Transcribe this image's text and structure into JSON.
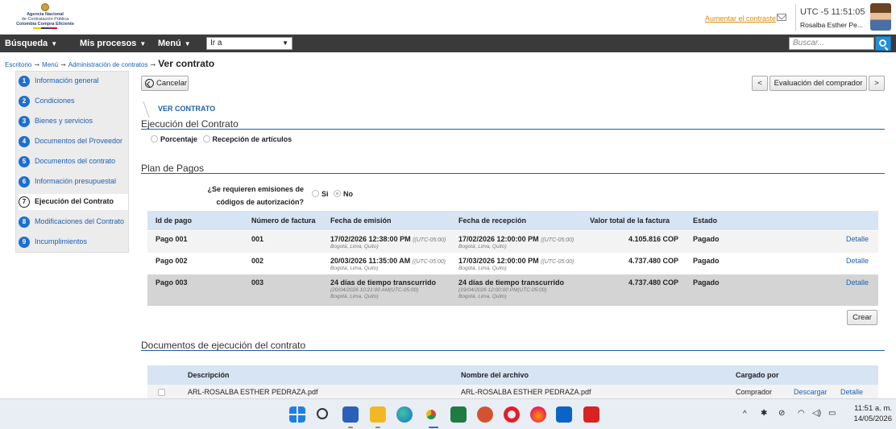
{
  "header": {
    "logo": {
      "line1": "Agencia Nacional",
      "line2": "de Contratación Pública",
      "line3": "Colombia Compra Eficiente"
    },
    "contrast_link": "Aumentar el contraste",
    "time": "UTC -5 11:51:05",
    "user_name": "Rosalba Esther Pe..."
  },
  "nav": {
    "busqueda": "Búsqueda",
    "mis_procesos": "Mis procesos",
    "menu": "Menú",
    "ira": "Ir a",
    "search_placeholder": "Buscar..."
  },
  "breadcrumb": {
    "items": [
      "Escritorio",
      "Menú",
      "Administración de contratos"
    ],
    "current": "Ver contrato"
  },
  "steps": [
    {
      "num": "1",
      "label": "Información general"
    },
    {
      "num": "2",
      "label": "Condiciones"
    },
    {
      "num": "3",
      "label": "Bienes y servicios"
    },
    {
      "num": "4",
      "label": "Documentos del Proveedor"
    },
    {
      "num": "5",
      "label": "Documentos del contrato"
    },
    {
      "num": "6",
      "label": "Información presupuestal"
    },
    {
      "num": "7",
      "label": "Ejecución del Contrato"
    },
    {
      "num": "8",
      "label": "Modificaciones del Contrato"
    },
    {
      "num": "9",
      "label": "Incumplimientos"
    }
  ],
  "toolbar": {
    "cancel": "Cancelar",
    "prev": "<",
    "eval": "Evaluación del comprador",
    "next": ">"
  },
  "tab_label": "VER CONTRATO",
  "ejecucion": {
    "title": "Ejecución del Contrato",
    "opt1": "Porcentaje",
    "opt2": "Recepción de artículos"
  },
  "plan": {
    "title": "Plan de Pagos",
    "question": "¿Se requieren emisiones de códigos de autorización?",
    "si": "Si",
    "no": "No",
    "columns": [
      "Id de pago",
      "Número de factura",
      "Fecha de emisión",
      "Fecha de recepción",
      "Valor total de la factura",
      "Estado"
    ],
    "rows": [
      {
        "id": "Pago 001",
        "factura": "001",
        "emision": "17/02/2026 12:38:00 PM",
        "emision_tz": "((UTC-05:00)",
        "emision_sub": "Bogotá, Lima, Quito)",
        "recepcion": "17/02/2026 12:00:00 PM",
        "recepcion_tz": "((UTC-05:00)",
        "recepcion_sub": "Bogotá, Lima, Quito)",
        "valor": "4.105.816 COP",
        "estado": "Pagado",
        "detalle": "Detalle"
      },
      {
        "id": "Pago 002",
        "factura": "002",
        "emision": "20/03/2026 11:35:00 AM",
        "emision_tz": "((UTC-05:00)",
        "emision_sub": "Bogotá, Lima, Quito)",
        "recepcion": "17/03/2026 12:00:00 PM",
        "recepcion_tz": "((UTC-05:00)",
        "recepcion_sub": "Bogotá, Lima, Quito)",
        "valor": "4.737.480 COP",
        "estado": "Pagado",
        "detalle": "Detalle"
      },
      {
        "id": "Pago 003",
        "factura": "003",
        "emision": "24 días de tiempo transcurrido",
        "emision_tz": "",
        "emision_sub": "(20/04/2026 10:21:00 AM(UTC-05:00)",
        "emision_sub2": "Bogotá, Lima, Quito)",
        "recepcion": "24 días de tiempo transcurrido",
        "recepcion_tz": "",
        "recepcion_sub": "(19/04/2026 12:00:00 PM(UTC-05:00)",
        "recepcion_sub2": "Bogotá, Lima, Quito)",
        "valor": "4.737.480 COP",
        "estado": "Pagado",
        "detalle": "Detalle"
      }
    ],
    "crear": "Crear"
  },
  "documentos": {
    "title": "Documentos de ejecución del contrato",
    "columns": [
      "Descripción",
      "Nombre del archivo",
      "Cargado por"
    ],
    "rows": [
      {
        "descripcion": "ARL-ROSALBA ESTHER PEDRAZA.pdf",
        "archivo": "ARL-ROSALBA ESTHER PEDRAZA.pdf",
        "cargado": "Comprador",
        "descargar": "Descargar",
        "detalle": "Detalle"
      }
    ]
  },
  "taskbar": {
    "time": "11:51 a. m.",
    "date": "14/05/2026"
  }
}
